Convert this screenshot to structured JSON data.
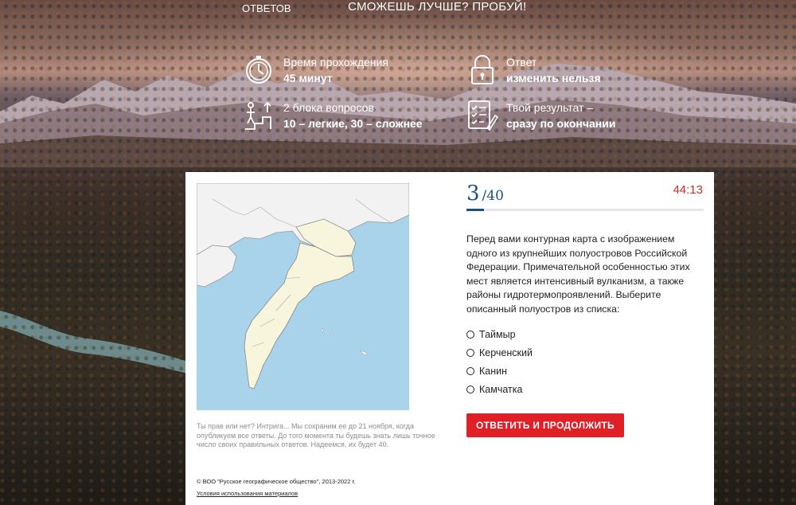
{
  "header": {
    "answers_link": "ОТВЕТОВ",
    "cta": "СМОЖЕШЬ ЛУЧШЕ? ПРОБУЙ!"
  },
  "info": {
    "time": {
      "title": "Время прохождения",
      "value": "45 минут",
      "icon": "stopwatch-icon"
    },
    "answer": {
      "title": "Ответ",
      "value": "изменить нельзя",
      "icon": "lock-icon"
    },
    "blocks": {
      "title": "2 блока вопросов",
      "value": "10 – легкие, 30 – сложнее",
      "icon": "steps-icon"
    },
    "result": {
      "title": "Твой результат –",
      "value": "сразу по окончании",
      "icon": "checklist-icon"
    }
  },
  "quiz": {
    "current": "3",
    "total": "/40",
    "timer": "44:13",
    "progress_fraction": 0.075,
    "question": "Перед вами контурная карта с изображением одного из крупнейших полуостровов Российской Федерации. Примечательной особенностью этих мест является интенсивный вулканизм, а также районы гидротермопроявлений. Выберите описанный полуостров из списка:",
    "options": [
      "Таймыр",
      "Керченский",
      "Канин",
      "Камчатка"
    ],
    "submit_label": "ОТВЕТИТЬ И ПРОДОЛЖИТЬ",
    "note": "Ты прав или нет? Интрига... Мы сохраним ее до 21 ноября, когда опубликуем все ответы. До того момента ты будешь знать лишь точное число своих правильных ответов. Надеемся, их будет 40."
  },
  "footer": {
    "copyright": "© ВОО \"Русское географическое общество\", 2013-2022 г.",
    "terms": "Условия использования материалов"
  },
  "colors": {
    "accent_blue": "#1a4f8a",
    "timer_red": "#d42b2b",
    "button_red": "#e01f26",
    "sea": "#a9d3ea",
    "land": "#f7f6dd",
    "land_other": "#f2f2f2"
  }
}
